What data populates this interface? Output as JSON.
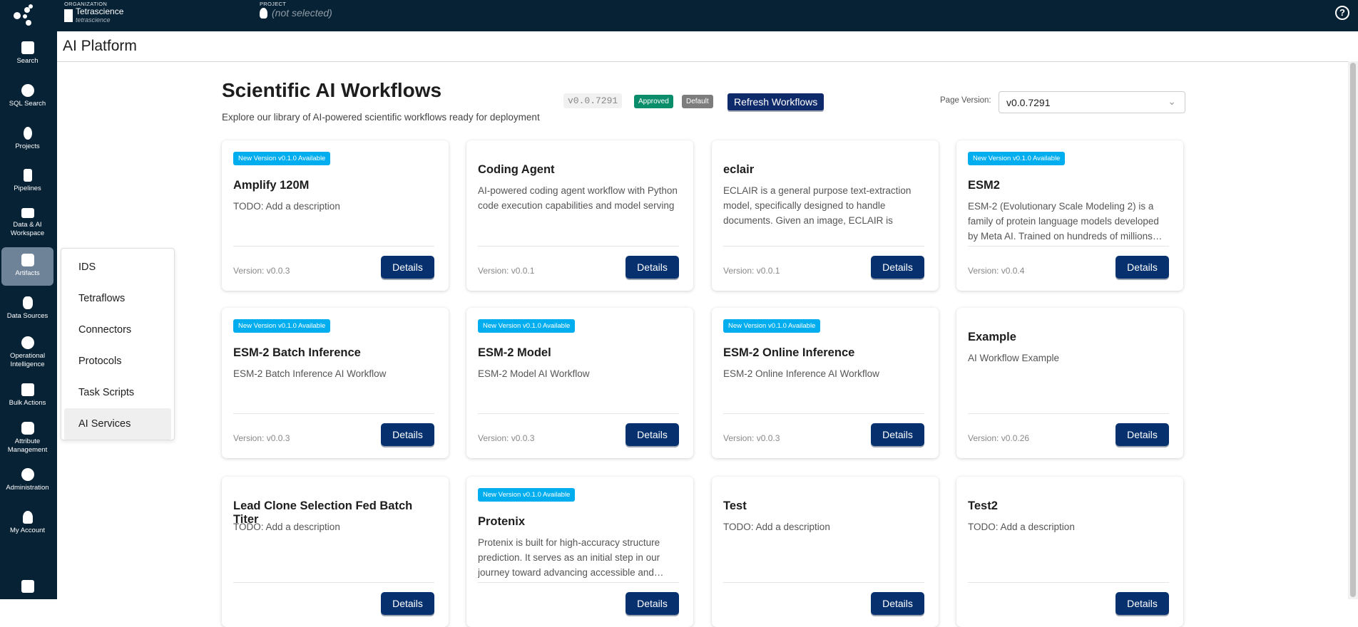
{
  "topbar": {
    "org_label": "ORGANIZATION",
    "org_name": "Tetrascience",
    "org_sub": "tetrascience",
    "project_label": "PROJECT",
    "project_value": "(not selected)",
    "help": "?"
  },
  "sidebar": [
    {
      "label": "Search"
    },
    {
      "label": "SQL Search"
    },
    {
      "label": "Projects"
    },
    {
      "label": "Pipelines"
    },
    {
      "label": "Data & AI Workspace"
    },
    {
      "label": "Artifacts"
    },
    {
      "label": "Data Sources"
    },
    {
      "label": "Operational Intelligence"
    },
    {
      "label": "Bulk Actions"
    },
    {
      "label": "Attribute Management"
    },
    {
      "label": "Administration"
    },
    {
      "label": "My Account"
    }
  ],
  "header": {
    "title": "AI Platform"
  },
  "page": {
    "title": "Scientific AI Workflows",
    "subtitle": "Explore our library of AI-powered scientific workflows ready for deployment",
    "version_tag": "v0.0.7291",
    "approved": "Approved",
    "default": "Default",
    "refresh": "Refresh Workflows",
    "page_version_label": "Page Version:",
    "page_version_value": "v0.0.7291"
  },
  "menu": [
    {
      "label": "IDS"
    },
    {
      "label": "Tetraflows"
    },
    {
      "label": "Connectors"
    },
    {
      "label": "Protocols"
    },
    {
      "label": "Task Scripts"
    },
    {
      "label": "AI Services"
    }
  ],
  "details_label": "Details",
  "cards": [
    {
      "badge": "New Version v0.1.0 Available",
      "title": "Amplify 120M",
      "desc": "TODO: Add a description",
      "version": "Version: v0.0.3"
    },
    {
      "badge": null,
      "title": "Coding Agent",
      "desc": "AI-powered coding agent workflow with Python code execution capabilities and model serving",
      "version": "Version: v0.0.1"
    },
    {
      "badge": null,
      "title": "eclair",
      "desc": "ECLAIR is a general purpose text-extraction model, specifically designed to handle documents. Given an image, ECLAIR is able…",
      "version": "Version: v0.0.1"
    },
    {
      "badge": "New Version v0.1.0 Available",
      "title": "ESM2",
      "desc": "ESM-2 (Evolutionary Scale Modeling 2) is a family of protein language models developed by Meta AI. Trained on hundreds of millions…",
      "version": "Version: v0.0.4"
    },
    {
      "badge": "New Version v0.1.0 Available",
      "title": "ESM-2 Batch Inference",
      "desc": "ESM-2 Batch Inference AI Workflow",
      "version": "Version: v0.0.3"
    },
    {
      "badge": "New Version v0.1.0 Available",
      "title": "ESM-2 Model",
      "desc": "ESM-2 Model AI Workflow",
      "version": "Version: v0.0.3"
    },
    {
      "badge": "New Version v0.1.0 Available",
      "title": "ESM-2 Online Inference",
      "desc": "ESM-2 Online Inference AI Workflow",
      "version": "Version: v0.0.3"
    },
    {
      "badge": null,
      "title": "Example",
      "desc": "AI Workflow Example",
      "version": "Version: v0.0.26"
    },
    {
      "badge": null,
      "title": "Lead Clone Selection Fed Batch Titer",
      "desc": "TODO: Add a description",
      "version": ""
    },
    {
      "badge": "New Version v0.1.0 Available",
      "title": "Protenix",
      "desc": "Protenix is built for high-accuracy structure prediction. It serves as an initial step in our journey toward advancing accessible and…",
      "version": ""
    },
    {
      "badge": null,
      "title": "Test",
      "desc": "TODO: Add a description",
      "version": ""
    },
    {
      "badge": null,
      "title": "Test2",
      "desc": "TODO: Add a description",
      "version": ""
    }
  ]
}
